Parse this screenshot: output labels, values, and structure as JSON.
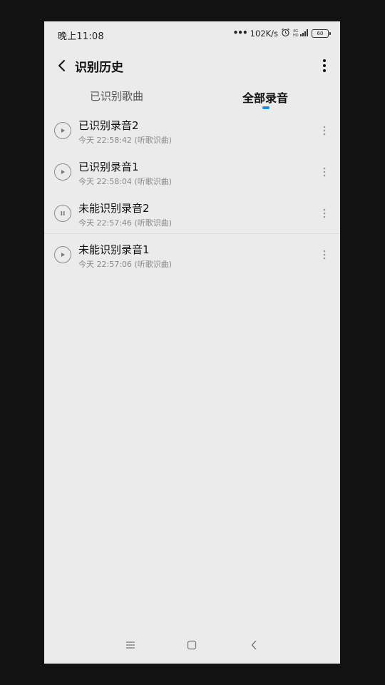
{
  "status_bar": {
    "time": "晚上11:08",
    "network_speed": "102K/s",
    "battery_level": "60",
    "icons": [
      "signal-dots-icon",
      "alarm-icon",
      "4g-signal-icon",
      "battery-icon"
    ]
  },
  "header": {
    "title": "识别历史",
    "back_icon": "chevron-left-icon",
    "more_icon": "vertical-dots-icon"
  },
  "tabs": [
    {
      "label": "已识别歌曲",
      "active": false
    },
    {
      "label": "全部录音",
      "active": true
    }
  ],
  "accent_color": "#1a8fd8",
  "recordings": [
    {
      "title": "已识别录音2",
      "subtitle": "今天 22:58:42 (听歌识曲)",
      "state": "play"
    },
    {
      "title": "已识别录音1",
      "subtitle": "今天 22:58:04 (听歌识曲)",
      "state": "play"
    },
    {
      "title": "未能识别录音2",
      "subtitle": "今天 22:57:46 (听歌识曲)",
      "state": "pause"
    },
    {
      "title": "未能识别录音1",
      "subtitle": "今天 22:57:06 (听歌识曲)",
      "state": "play"
    }
  ],
  "nav_bar": {
    "icons": [
      "menu-icon",
      "home-square-icon",
      "back-chevron-icon"
    ]
  }
}
